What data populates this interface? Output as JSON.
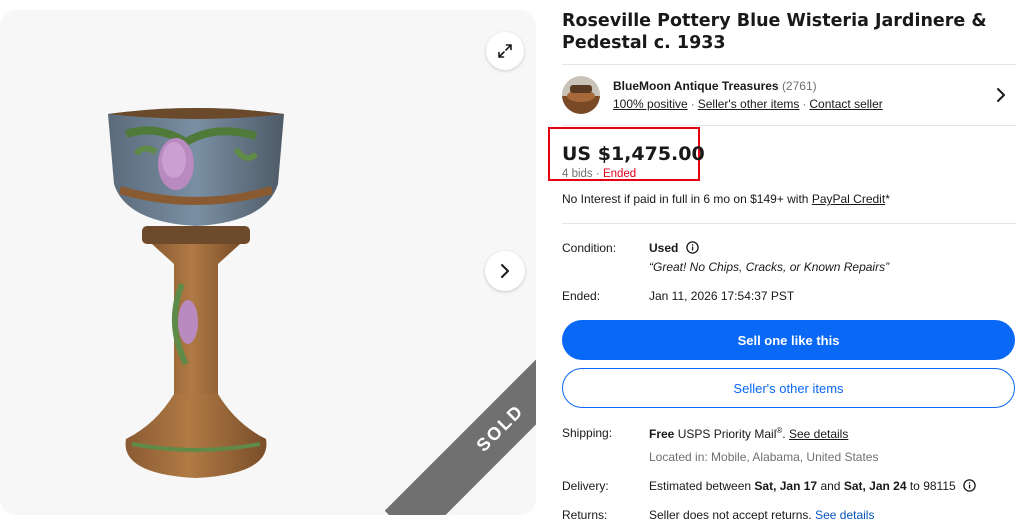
{
  "gallery": {
    "sold_label": "SOLD",
    "expand_icon": "expand-arrows-icon",
    "next_icon": "chevron-right-icon"
  },
  "listing": {
    "title": "Roseville Pottery Blue Wisteria Jardinere & Pedestal c. 1933"
  },
  "seller": {
    "name": "BlueMoon Antique Treasures",
    "count": "(2761)",
    "positive": "100% positive",
    "other_items": "Seller's other items",
    "contact": "Contact seller"
  },
  "price": {
    "amount": "US $1,475.00",
    "bids": "4 bids",
    "separator": "·",
    "status": "Ended",
    "credit_prefix": "No Interest if paid in full in 6 mo on $149+ with ",
    "credit_link": "PayPal Credit",
    "credit_suffix": "*",
    "highlight_color": "#e60012"
  },
  "condition": {
    "label": "Condition:",
    "value": "Used",
    "quote": "“Great! No Chips, Cracks, or Known Repairs”"
  },
  "ended": {
    "label": "Ended:",
    "value": "Jan 11, 2026 17:54:37 PST"
  },
  "buttons": {
    "sell": "Sell one like this",
    "other_items": "Seller's other items",
    "accent": "#0968f6"
  },
  "shipping": {
    "label": "Shipping:",
    "free": "Free",
    "method": " USPS Priority Mail",
    "reg": "®",
    "period": ". ",
    "details": "See details",
    "location": "Located in: Mobile, Alabama, United States"
  },
  "delivery": {
    "label": "Delivery:",
    "prefix": "Estimated between ",
    "start": "Sat, Jan 17",
    "and": " and ",
    "end": "Sat, Jan 24",
    "zip": " to 98115"
  },
  "returns": {
    "label": "Returns:",
    "text": "Seller does not accept returns. ",
    "details": "See details"
  }
}
